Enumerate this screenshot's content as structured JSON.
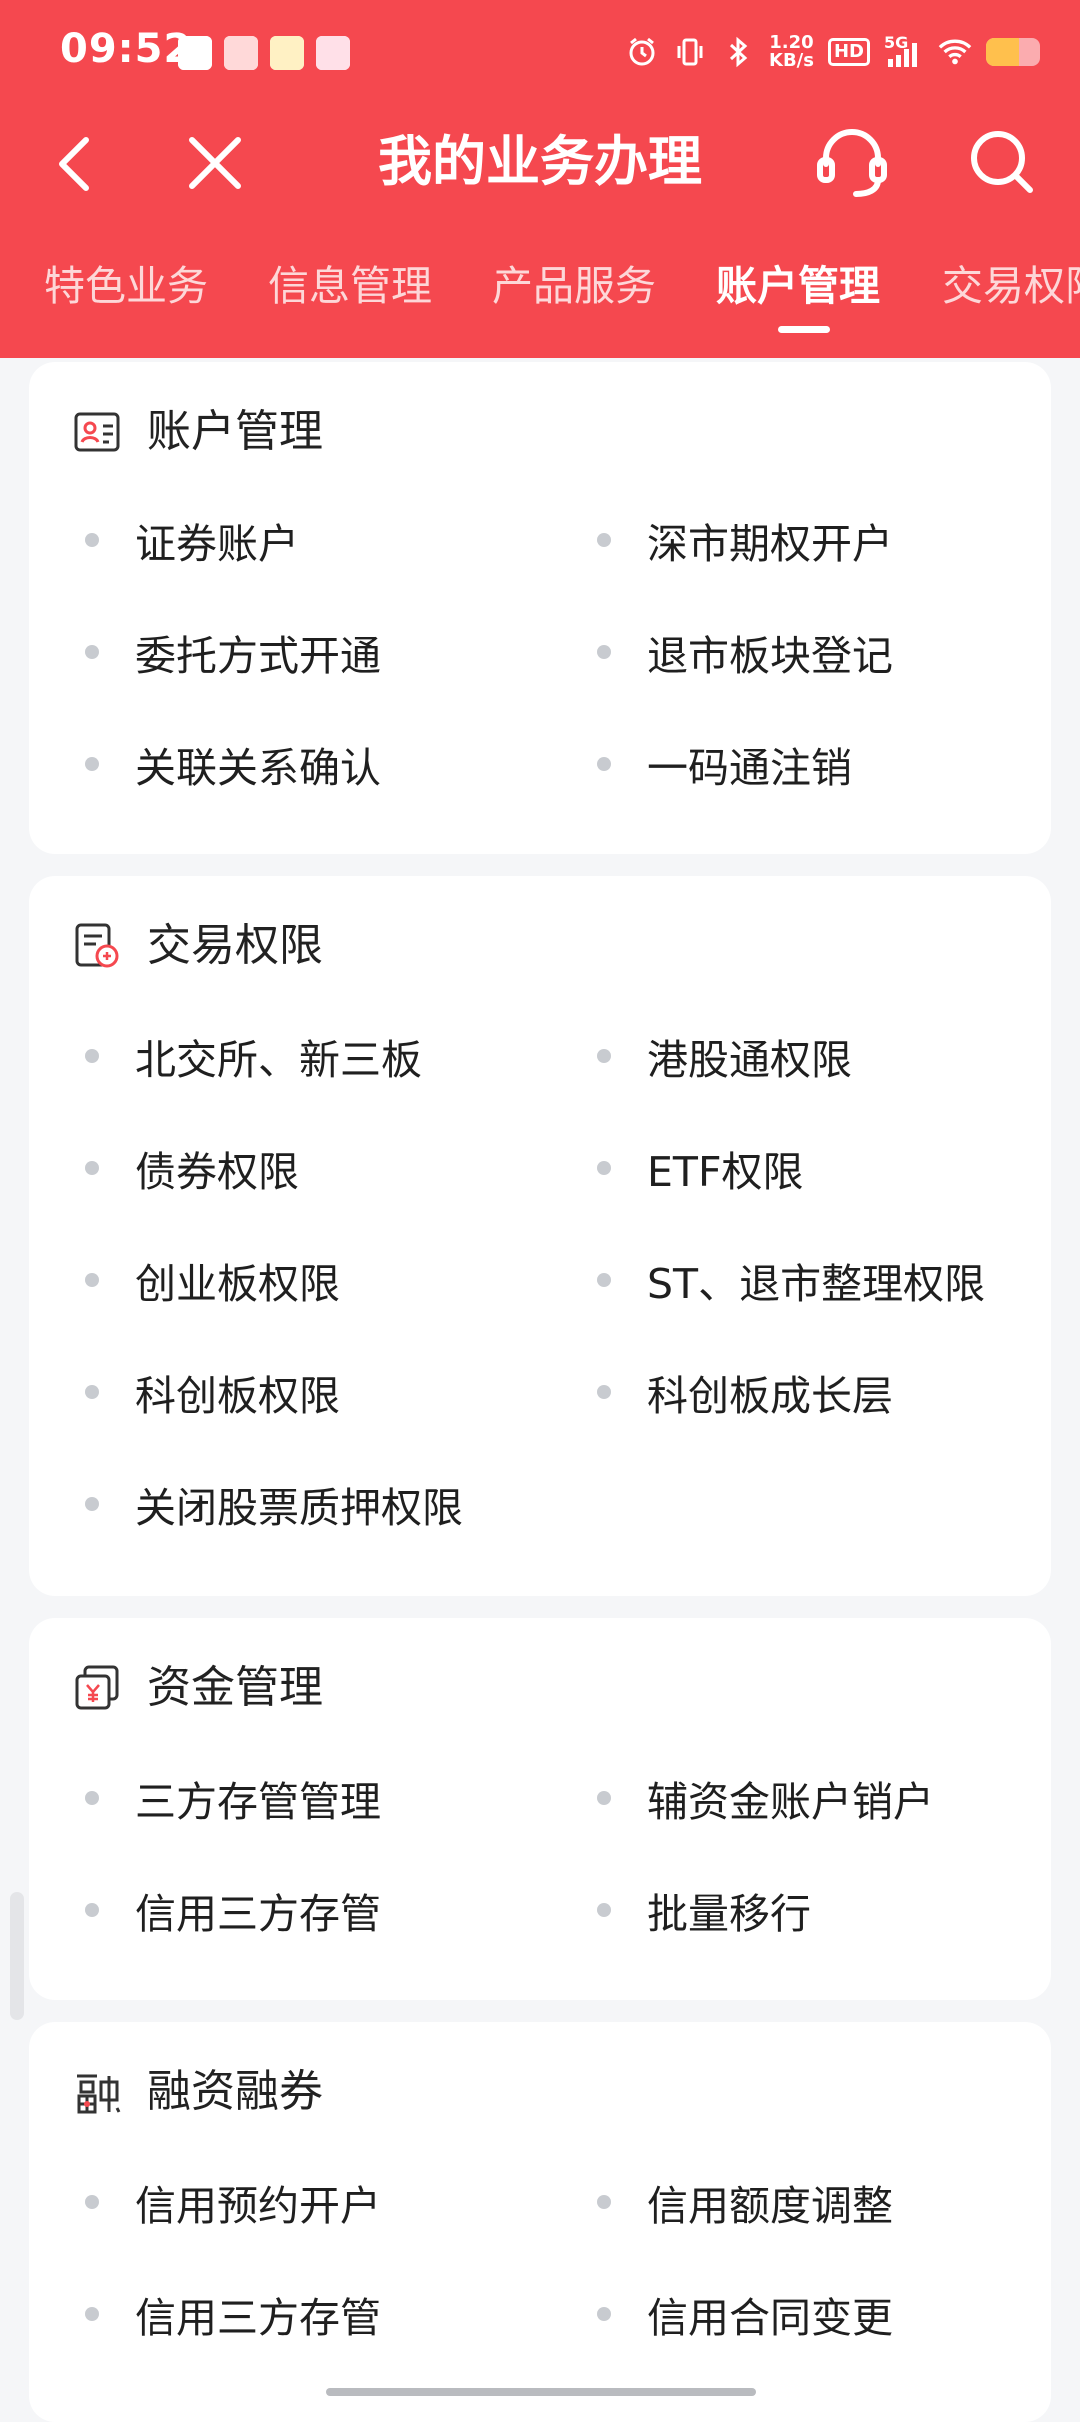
{
  "status_bar": {
    "time": "09:52",
    "net_speed_value": "1.20",
    "net_speed_unit": "KB/s",
    "hd_label": "HD",
    "signal_label": "5G"
  },
  "header": {
    "title": "我的业务办理"
  },
  "tabs": [
    {
      "label": "特色业务",
      "active": false
    },
    {
      "label": "信息管理",
      "active": false
    },
    {
      "label": "产品服务",
      "active": false
    },
    {
      "label": "账户管理",
      "active": true
    },
    {
      "label": "交易权限",
      "active": false
    }
  ],
  "sections": [
    {
      "title": "账户管理",
      "icon": "account-card-icon",
      "items": [
        "证券账户",
        "深市期权开户",
        "委托方式开通",
        "退市板块登记",
        "关联关系确认",
        "一码通注销"
      ]
    },
    {
      "title": "交易权限",
      "icon": "trade-permission-icon",
      "items": [
        "北交所、新三板",
        "港股通权限",
        "债券权限",
        "ETF权限",
        "创业板权限",
        "ST、退市整理权限",
        "科创板权限",
        "科创板成长层",
        "关闭股票质押权限"
      ]
    },
    {
      "title": "资金管理",
      "icon": "yuan-fund-icon",
      "items": [
        "三方存管管理",
        "辅资金账户销户",
        "信用三方存管",
        "批量移行"
      ]
    },
    {
      "title": "融资融券",
      "icon": "margin-trading-icon",
      "items": [
        "信用预约开户",
        "信用额度调整",
        "信用三方存管",
        "信用合同变更"
      ]
    }
  ],
  "colors": {
    "header_bg": "#f5484f",
    "accent": "#f5484f",
    "page_bg": "#f5f6f8"
  }
}
